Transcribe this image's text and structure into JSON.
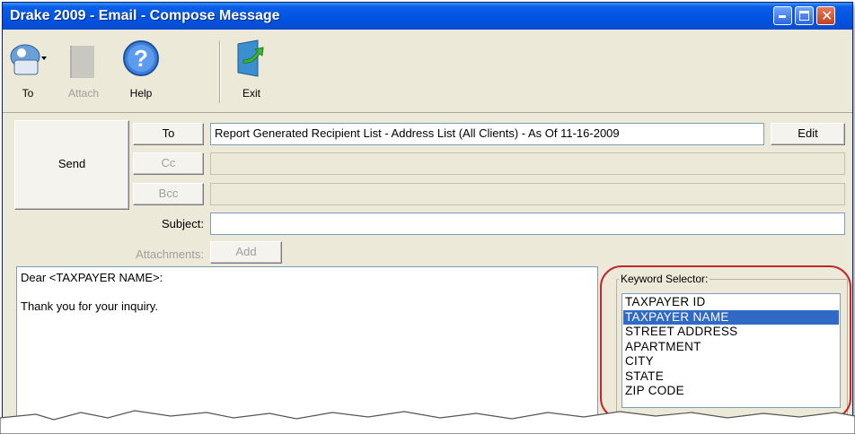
{
  "window": {
    "title": "Drake 2009 - Email - Compose Message"
  },
  "toolbar": {
    "to_label": "To",
    "attach_label": "Attach",
    "help_label": "Help",
    "exit_label": "Exit"
  },
  "compose": {
    "send_label": "Send",
    "to_button": "To",
    "cc_button": "Cc",
    "bcc_button": "Bcc",
    "to_value": "Report Generated Recipient List - Address List (All Clients) - As Of 11-16-2009",
    "edit_label": "Edit",
    "subject_label": "Subject:",
    "attachments_label": "Attachments:",
    "add_label": "Add"
  },
  "message": {
    "line1": "Dear <TAXPAYER NAME>:",
    "line2": "Thank you for your inquiry."
  },
  "keywords": {
    "title": "Keyword Selector:",
    "items": [
      "TAXPAYER ID",
      "TAXPAYER NAME",
      "STREET ADDRESS",
      "APARTMENT",
      "CITY",
      "STATE",
      "ZIP CODE"
    ],
    "selected": "TAXPAYER NAME"
  },
  "colors": {
    "titlebar": "#0054e3",
    "selection": "#316ac5",
    "highlight_oval": "#c0272d"
  }
}
